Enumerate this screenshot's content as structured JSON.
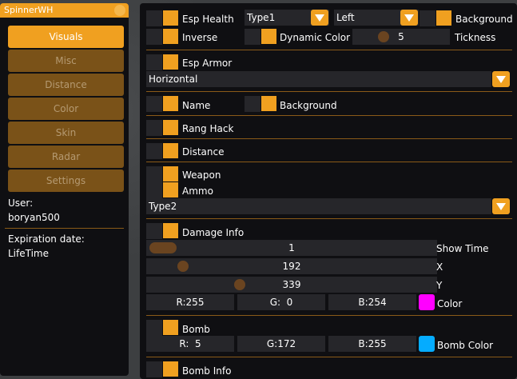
{
  "left": {
    "title": "SpinnerWH",
    "menu": [
      {
        "label": "Visuals",
        "active": true
      },
      {
        "label": "Misc",
        "active": false
      },
      {
        "label": "Distance",
        "active": false
      },
      {
        "label": "Color",
        "active": false
      },
      {
        "label": "Skin",
        "active": false
      },
      {
        "label": "Radar",
        "active": false
      },
      {
        "label": "Settings",
        "active": false
      }
    ],
    "user_label": "User:",
    "user_value": "boryan500",
    "expiration_label": "Expiration date:",
    "expiration_value": "LifeTime"
  },
  "esp_health": {
    "label": "Esp Health",
    "type_combo": "Type1",
    "side_combo": "Left",
    "background_label": "Background",
    "inverse_label": "Inverse",
    "dynamic_color_label": "Dynamic Color",
    "thickness_value": "5",
    "thickness_label": "Tickness"
  },
  "esp_armor": {
    "label": "Esp Armor",
    "orientation_combo": "Horizontal"
  },
  "name": {
    "label": "Name",
    "background_label": "Background"
  },
  "rang_hack": {
    "label": "Rang Hack"
  },
  "distance": {
    "label": "Distance"
  },
  "weapon": {
    "label": "Weapon",
    "ammo_label": "Ammo",
    "type_combo": "Type2"
  },
  "damage_info": {
    "label": "Damage Info",
    "show_time_value": "1",
    "show_time_label": "Show Time",
    "x_value": "192",
    "x_label": "X",
    "y_value": "339",
    "y_label": "Y",
    "r": "R:255",
    "g": "G:  0",
    "b": "B:254",
    "color_label": "Color",
    "color": "#ff00ff"
  },
  "bomb": {
    "label": "Bomb",
    "r": "R:  5",
    "g": "G:172",
    "b": "B:255",
    "color_label": "Bomb Color",
    "color": "#05acff"
  },
  "bomb_info": {
    "label": "Bomb Info"
  }
}
